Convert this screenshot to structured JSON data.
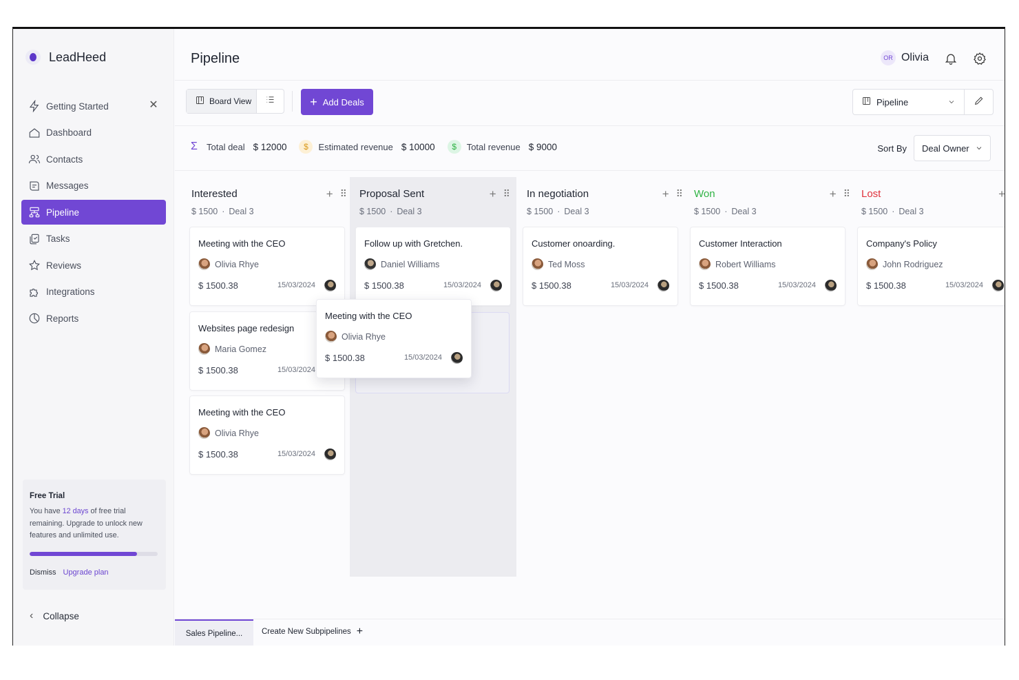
{
  "brand": {
    "name": "LeadHeed"
  },
  "sidebar": {
    "items": [
      {
        "label": "Getting Started",
        "icon": "bolt-icon",
        "closable": true
      },
      {
        "label": "Dashboard",
        "icon": "home-icon"
      },
      {
        "label": "Contacts",
        "icon": "users-icon"
      },
      {
        "label": "Messages",
        "icon": "message-icon"
      },
      {
        "label": "Pipeline",
        "icon": "pipeline-icon",
        "active": true
      },
      {
        "label": "Tasks",
        "icon": "tasks-icon"
      },
      {
        "label": "Reviews",
        "icon": "star-icon"
      },
      {
        "label": "Integrations",
        "icon": "puzzle-icon"
      },
      {
        "label": "Reports",
        "icon": "chart-pie-icon"
      }
    ],
    "trial": {
      "title": "Free Trial",
      "text_before": "You have ",
      "days": "12 days",
      "text_after": " of free trial remaining. Upgrade to unlock new features and unlimited use.",
      "progress": 0.84,
      "dismiss_label": "Dismiss",
      "upgrade_label": "Upgrade plan"
    },
    "collapse_label": "Collapse"
  },
  "header": {
    "title": "Pipeline",
    "user_initials": "OR",
    "user_name": "Olivia"
  },
  "toolbar": {
    "board_view_label": "Board View",
    "add_deals_label": "Add Deals",
    "pipeline_select_value": "Pipeline"
  },
  "stats": {
    "total_deal_label": "Total deal",
    "total_deal_value": "$ 12000",
    "estimated_revenue_label": "Estimated revenue",
    "estimated_revenue_value": "$ 10000",
    "total_revenue_label": "Total revenue",
    "total_revenue_value": "$ 9000",
    "sort_label": "Sort By",
    "sort_value": "Deal Owner"
  },
  "colors": {
    "accent": "#7147d4",
    "won": "#2fb344",
    "lost": "#e0323c"
  },
  "columns": [
    {
      "title": "Interested",
      "amount": "$ 1500",
      "deals": "Deal 3",
      "color": "#1f2430",
      "cards": [
        {
          "title": "Meeting with the CEO",
          "person": "Olivia Rhye",
          "amount": "$ 1500.38",
          "date": "15/03/2024"
        },
        {
          "title": "Websites page redesign",
          "person": "Maria Gomez",
          "amount": "$ 1500.38",
          "date": "15/03/2024"
        },
        {
          "title": "Meeting with the CEO",
          "person": "Olivia Rhye",
          "amount": "$ 1500.38",
          "date": "15/03/2024"
        }
      ]
    },
    {
      "title": "Proposal Sent",
      "amount": "$ 1500",
      "deals": "Deal 3",
      "color": "#1f2430",
      "cards": [
        {
          "title": "Follow up with Gretchen.",
          "person": "Daniel Williams",
          "amount": "$ 1500.38",
          "date": "15/03/2024"
        }
      ]
    },
    {
      "title": "In negotiation",
      "amount": "$ 1500",
      "deals": "Deal 3",
      "color": "#1f2430",
      "cards": [
        {
          "title": "Customer onoarding.",
          "person": "Ted Moss",
          "amount": "$ 1500.38",
          "date": "15/03/2024"
        }
      ]
    },
    {
      "title": "Won",
      "amount": "$ 1500",
      "deals": "Deal 3",
      "color": "#2fb344",
      "cards": [
        {
          "title": "Customer Interaction",
          "person": "Robert Williams",
          "amount": "$ 1500.38",
          "date": "15/03/2024"
        }
      ]
    },
    {
      "title": "Lost",
      "amount": "$ 1500",
      "deals": "Deal 3",
      "color": "#e0323c",
      "cards": [
        {
          "title": "Company's Policy",
          "person": "John Rodriguez",
          "amount": "$ 1500.38",
          "date": "15/03/2024"
        }
      ]
    }
  ],
  "dragging_card": {
    "title": "Meeting with the CEO",
    "person": "Olivia Rhye",
    "amount": "$ 1500.38",
    "date": "15/03/2024"
  },
  "bottom_tabs": {
    "active_label": "Sales Pipeline...",
    "create_label": "Create New Subpipelines"
  }
}
